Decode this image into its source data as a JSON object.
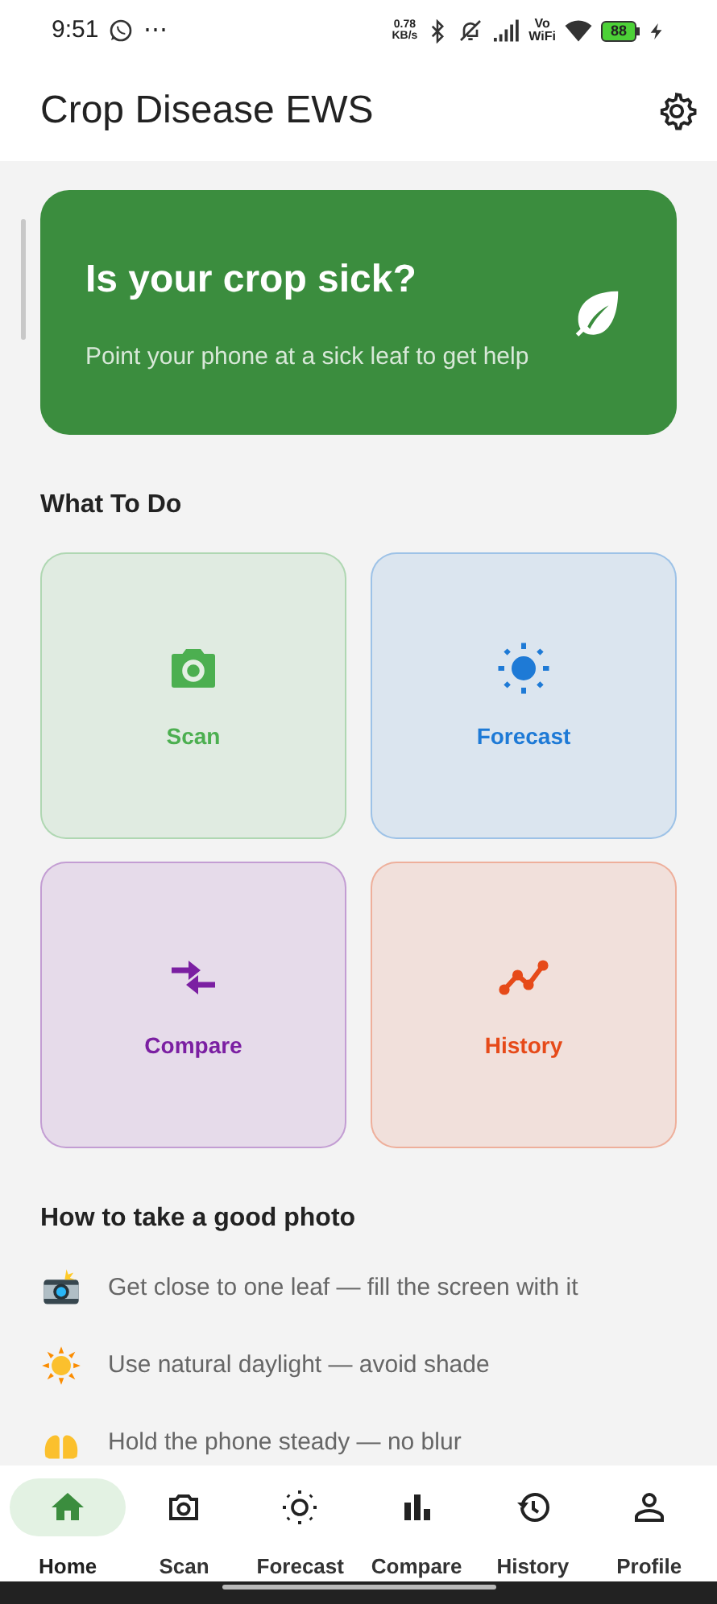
{
  "status_bar": {
    "time": "9:51",
    "more": "⋯",
    "speed_value": "0.78",
    "speed_unit": "KB/s",
    "volte_top": "Vo",
    "volte_bottom": "WiFi",
    "battery": "88"
  },
  "app_bar": {
    "title": "Crop Disease EWS"
  },
  "hero": {
    "title": "Is your crop sick?",
    "subtitle": "Point your phone at a sick leaf to get help"
  },
  "actions_heading": "What To Do",
  "actions": [
    {
      "label": "Scan",
      "kind": "camera",
      "color": "#4caf50"
    },
    {
      "label": "Forecast",
      "kind": "sun",
      "color": "#1e7ad6"
    },
    {
      "label": "Compare",
      "kind": "arrows",
      "color": "#7b1fa2"
    },
    {
      "label": "History",
      "kind": "trend",
      "color": "#e64a19"
    }
  ],
  "tips_heading": "How to take a good photo",
  "tips": [
    {
      "kind": "camera",
      "text": "Get close to one leaf — fill the screen with it"
    },
    {
      "kind": "sun",
      "text": "Use natural daylight — avoid shade"
    },
    {
      "kind": "hands",
      "text": "Hold the phone steady — no blur"
    }
  ],
  "nav": [
    {
      "label": "Home",
      "kind": "home",
      "selected": true
    },
    {
      "label": "Scan",
      "kind": "camera",
      "selected": false
    },
    {
      "label": "Forecast",
      "kind": "sun",
      "selected": false
    },
    {
      "label": "Compare",
      "kind": "bars",
      "selected": false
    },
    {
      "label": "History",
      "kind": "history",
      "selected": false
    },
    {
      "label": "Profile",
      "kind": "person",
      "selected": false
    }
  ]
}
